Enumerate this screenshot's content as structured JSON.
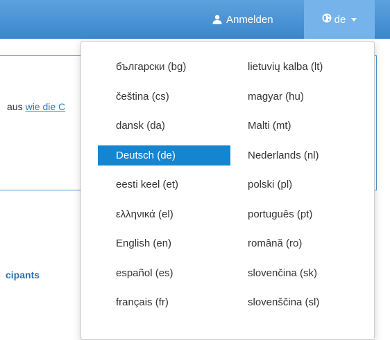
{
  "header": {
    "login_label": "Anmelden",
    "language_label": "de"
  },
  "background": {
    "info_prefix": "aus",
    "info_link": "wie die C",
    "section_heading": "cipants"
  },
  "dropdown": {
    "left_items": [
      {
        "label": "български (bg)",
        "active": false
      },
      {
        "label": "čeština (cs)",
        "active": false
      },
      {
        "label": "dansk (da)",
        "active": false
      },
      {
        "label": "Deutsch (de)",
        "active": true
      },
      {
        "label": "eesti keel (et)",
        "active": false
      },
      {
        "label": "ελληνικά (el)",
        "active": false
      },
      {
        "label": "English (en)",
        "active": false
      },
      {
        "label": "español (es)",
        "active": false
      },
      {
        "label": "français (fr)",
        "active": false
      }
    ],
    "right_items": [
      {
        "label": "lietuvių kalba (lt)",
        "active": false
      },
      {
        "label": "magyar (hu)",
        "active": false
      },
      {
        "label": "Malti (mt)",
        "active": false
      },
      {
        "label": "Nederlands (nl)",
        "active": false
      },
      {
        "label": "polski (pl)",
        "active": false
      },
      {
        "label": "português (pt)",
        "active": false
      },
      {
        "label": "română (ro)",
        "active": false
      },
      {
        "label": "slovenčina (sk)",
        "active": false
      },
      {
        "label": "slovenščina (sl)",
        "active": false
      }
    ]
  },
  "colors": {
    "header": "#3b86cb",
    "active_language": "#1585cf",
    "link": "#2a7bc0"
  }
}
